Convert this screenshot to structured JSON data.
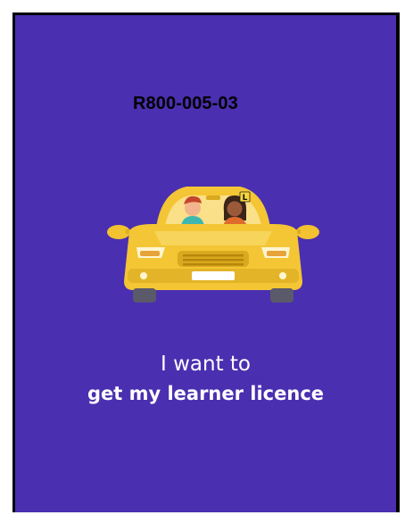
{
  "card": {
    "code": "R800-005-03",
    "line1": "I want to",
    "line2": "get my learner licence",
    "background_color": "#4a2fb0",
    "illustration": "car-with-driver-and-learner-icon"
  }
}
